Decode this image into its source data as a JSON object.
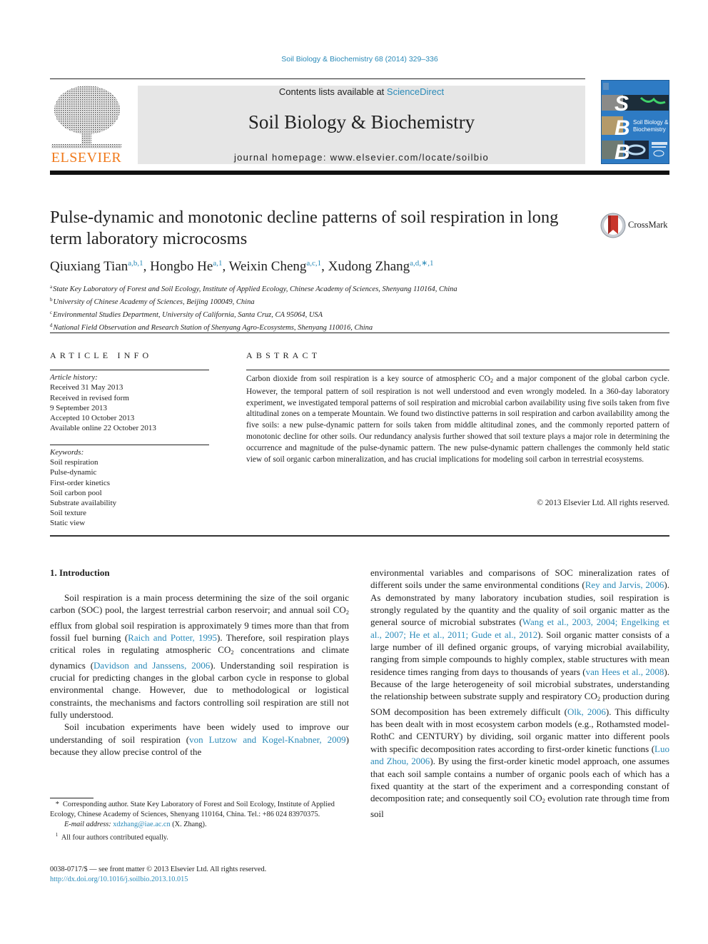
{
  "header": {
    "citation": "Soil Biology & Biochemistry 68 (2014) 329–336",
    "contents_prefix": "Contents lists available at ",
    "contents_link": "ScienceDirect",
    "journal_title": "Soil Biology & Biochemistry",
    "homepage_prefix": "journal homepage: ",
    "homepage_url": "www.elsevier.com/locate/soilbio",
    "publisher_logo_text": "ELSEVIER",
    "cover": {
      "letters": [
        "S",
        "B",
        "B"
      ],
      "subtitle_line1": "Soil Biology &",
      "subtitle_line2": "Biochemistry"
    },
    "colors": {
      "link": "#2a8ab8",
      "elsevier_orange": "#f07a1c",
      "band_grey": "#e6e6e6",
      "cover_blue": "#2e7bc4"
    }
  },
  "article": {
    "title": "Pulse-dynamic and monotonic decline patterns of soil respiration in long term laboratory microcosms",
    "crossmark_label": "CrossMark",
    "authors": [
      {
        "name": "Qiuxiang Tian",
        "sup": "a,b,1"
      },
      {
        "name": "Hongbo He",
        "sup": "a,1"
      },
      {
        "name": "Weixin Cheng",
        "sup": "a,c,1"
      },
      {
        "name": "Xudong Zhang",
        "sup": "a,d,∗,1"
      }
    ],
    "affiliations": [
      {
        "key": "a",
        "text": "State Key Laboratory of Forest and Soil Ecology, Institute of Applied Ecology, Chinese Academy of Sciences, Shenyang 110164, China"
      },
      {
        "key": "b",
        "text": "University of Chinese Academy of Sciences, Beijing 100049, China"
      },
      {
        "key": "c",
        "text": "Environmental Studies Department, University of California, Santa Cruz, CA 95064, USA"
      },
      {
        "key": "d",
        "text": "National Field Observation and Research Station of Shenyang Agro-Ecosystems, Shenyang 110016, China"
      }
    ]
  },
  "article_info": {
    "heading": "ARTICLE INFO",
    "history_label": "Article history:",
    "history": [
      "Received 31 May 2013",
      "Received in revised form",
      "9 September 2013",
      "Accepted 10 October 2013",
      "Available online 22 October 2013"
    ],
    "keywords_label": "Keywords:",
    "keywords": [
      "Soil respiration",
      "Pulse-dynamic",
      "First-order kinetics",
      "Soil carbon pool",
      "Substrate availability",
      "Soil texture",
      "Static view"
    ]
  },
  "abstract": {
    "heading": "ABSTRACT",
    "part1": "Carbon dioxide from soil respiration is a key source of atmospheric CO",
    "part2": " and a major component of the global carbon cycle. However, the temporal pattern of soil respiration is not well understood and even wrongly modeled. In a 360-day laboratory experiment, we investigated temporal patterns of soil respiration and microbial carbon availability using five soils taken from five altitudinal zones on a temperate Mountain. We found two distinctive patterns in soil respiration and carbon availability among the five soils: a new pulse-dynamic pattern for soils taken from middle altitudinal zones, and the commonly reported pattern of monotonic decline for other soils. Our redundancy analysis further showed that soil texture plays a major role in determining the occurrence and magnitude of the pulse-dynamic pattern. The new pulse-dynamic pattern challenges the commonly held static view of soil organic carbon mineralization, and has crucial implications for modeling soil carbon in terrestrial ecosystems.",
    "copyright": "© 2013 Elsevier Ltd. All rights reserved."
  },
  "body": {
    "section_heading": "1.  Introduction",
    "sub2": "2",
    "left": {
      "p1_a": "Soil respiration is a main process determining the size of the soil organic carbon (SOC) pool, the largest terrestrial carbon reservoir; and annual soil CO",
      "p1_b": " efflux from global soil respiration is approximately 9 times more than that from fossil fuel burning (",
      "p1_ref1": "Raich and Potter, 1995",
      "p1_c": "). Therefore, soil respiration plays critical roles in regulating atmospheric CO",
      "p1_d": " concentrations and climate dynamics (",
      "p1_ref2": "Davidson and Janssens, 2006",
      "p1_e": "). Understanding soil respiration is crucial for predicting changes in the global carbon cycle in response to global environmental change. However, due to methodological or logistical constraints, the mechanisms and factors controlling soil respiration are still not fully understood.",
      "p2_a": "Soil incubation experiments have been widely used to improve our understanding of soil respiration (",
      "p2_ref1": "von Lutzow and Kogel-Knabner, 2009",
      "p2_b": ") because they allow precise control of the"
    },
    "right": {
      "a": "environmental variables and comparisons of SOC mineralization rates of different soils under the same environmental conditions (",
      "ref1": "Rey and Jarvis, 2006",
      "b": "). As demonstrated by many laboratory incubation studies, soil respiration is strongly regulated by the quantity and the quality of soil organic matter as the general source of microbial substrates (",
      "ref2": "Wang et al., 2003, 2004; Engelking et al., 2007; He et al., 2011; Gude et al., 2012",
      "c": "). Soil organic matter consists of a large number of ill defined organic groups, of varying microbial availability, ranging from simple compounds to highly complex, stable structures with mean residence times ranging from days to thousands of years (",
      "ref3": "van Hees et al., 2008",
      "d": "). Because of the large heterogeneity of soil microbial substrates, understanding the relationship between substrate supply and respiratory CO",
      "e": " production during SOM decomposition has been extremely difficult (",
      "ref4": "Olk, 2006",
      "f": "). This difficulty has been dealt with in most ecosystem carbon models (e.g., Rothamsted model-RothC and CENTURY) by dividing, soil organic matter into different pools with specific decomposition rates according to first-order kinetic functions (",
      "ref5": "Luo and Zhou, 2006",
      "g": "). By using the first-order kinetic model approach, one assumes that each soil sample contains a number of organic pools each of which has a fixed quantity at the start of the experiment and a corresponding constant of decomposition rate; and consequently soil CO",
      "h": " evolution rate through time from soil"
    }
  },
  "footnotes": {
    "corresponding_mark": "*",
    "corresponding": "Corresponding author. State Key Laboratory of Forest and Soil Ecology, Institute of Applied Ecology, Chinese Academy of Sciences, Shenyang 110164, China. Tel.: +86 024 83970375.",
    "email_label": "E-mail address:",
    "email": "xdzhang@iae.ac.cn",
    "email_suffix": " (X. Zhang).",
    "note1_mark": "1",
    "note1": "All four authors contributed equally.",
    "front_matter": "0038-0717/$ — see front matter © 2013 Elsevier Ltd. All rights reserved.",
    "doi": "http://dx.doi.org/10.1016/j.soilbio.2013.10.015"
  }
}
